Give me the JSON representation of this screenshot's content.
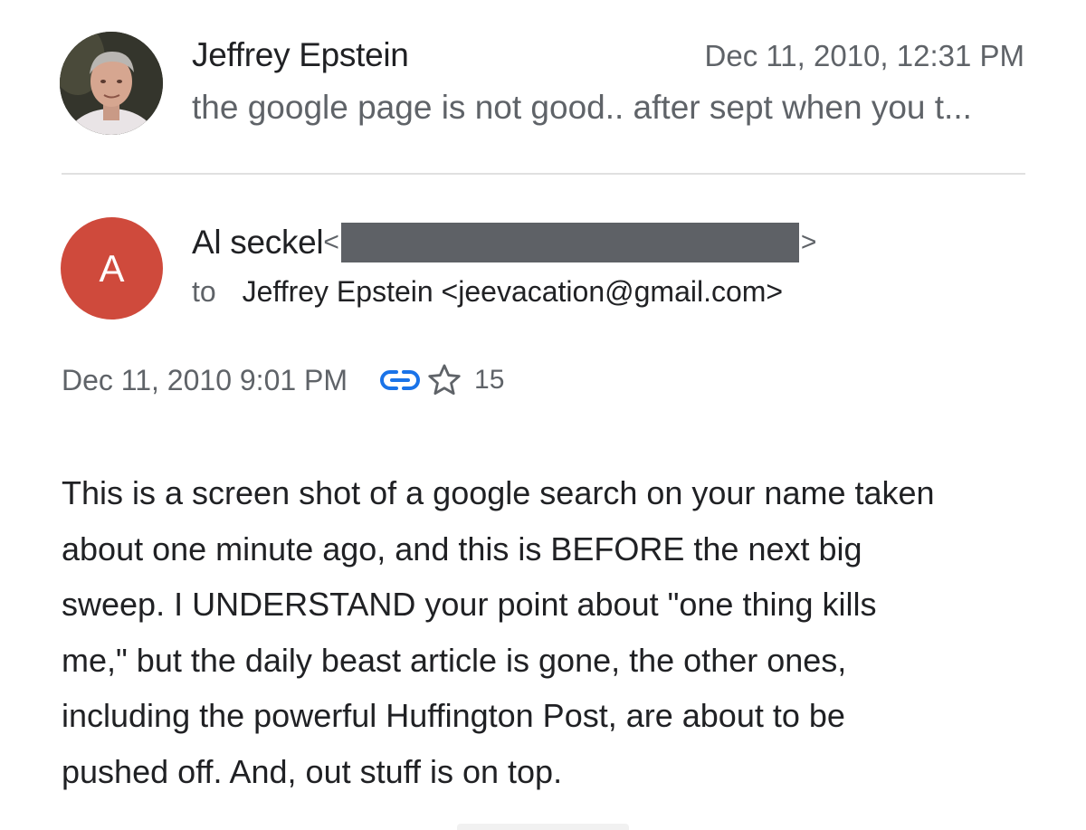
{
  "previous_message": {
    "sender": "Jeffrey Epstein",
    "date": "Dec 11, 2010, 12:31 PM",
    "snippet": "the google page is not good.. after sept when you t..."
  },
  "message": {
    "avatar_letter": "A",
    "avatar_color": "#cf4a3c",
    "sender_name": "Al seckel",
    "email_open": "<",
    "email_close": ">",
    "to_label": "to",
    "recipient": "Jeffrey Epstein <jeevacation@gmail.com>",
    "date": "Dec 11, 2010 9:01 PM",
    "link_icon": "link-icon",
    "link_icon_color": "#1a73e8",
    "star_icon": "star-outline-icon",
    "star_count": "15",
    "body_lines": [
      "This is a screen shot of a google search on your name taken",
      "about one minute ago, and this is BEFORE the next big",
      "sweep. I UNDERSTAND your point about \"one thing kills",
      "me,\" but the daily beast article is gone, the other ones,",
      "including the powerful Huffington Post, are about to be",
      "pushed off. And, out stuff is on top."
    ]
  }
}
